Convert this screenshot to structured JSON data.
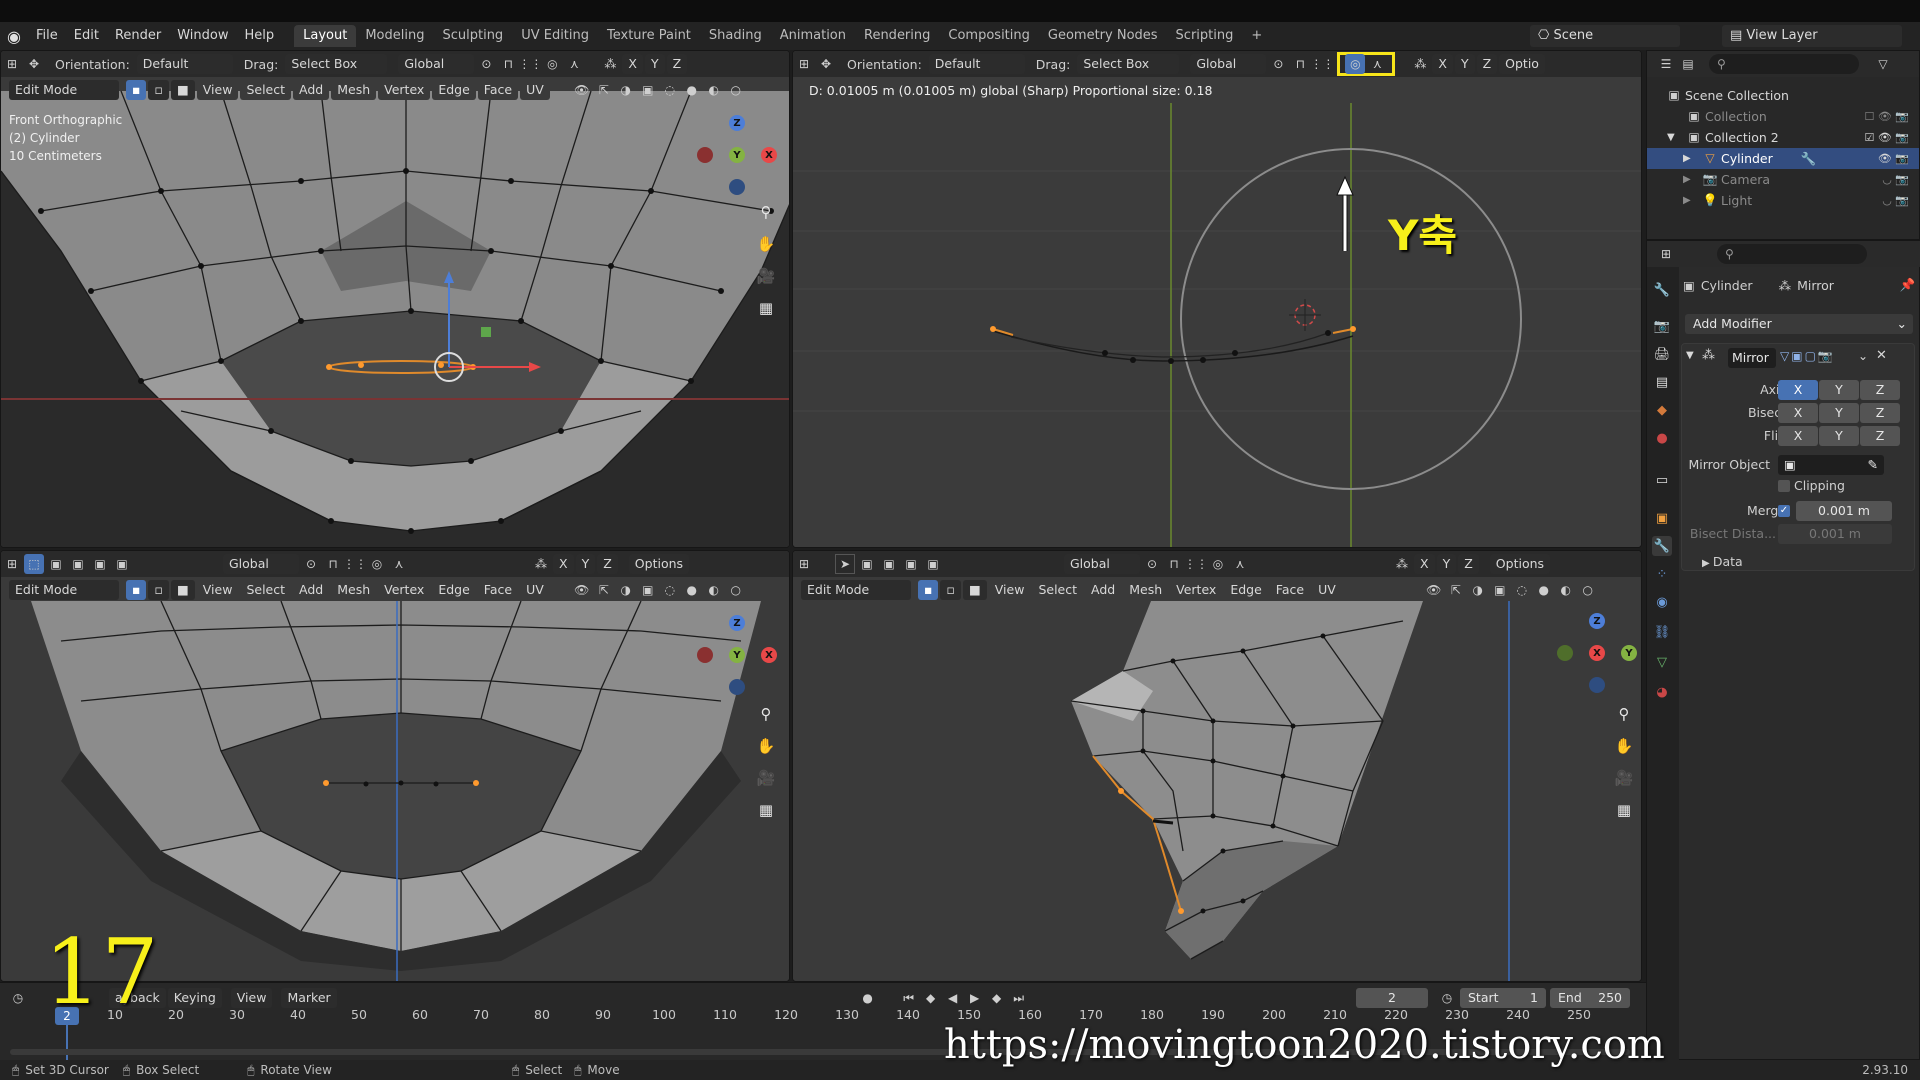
{
  "topbar": {
    "menus": [
      "File",
      "Edit",
      "Render",
      "Window",
      "Help"
    ],
    "workspaces": [
      "Layout",
      "Modeling",
      "Sculpting",
      "UV Editing",
      "Texture Paint",
      "Shading",
      "Animation",
      "Rendering",
      "Compositing",
      "Geometry Nodes",
      "Scripting"
    ],
    "active_workspace": "Layout",
    "add_tab": "+",
    "scene": "Scene",
    "view_layer": "View Layer"
  },
  "viewport_tl": {
    "orientation_label": "Orientation:",
    "orientation_value": "Default",
    "drag_label": "Drag:",
    "drag_value": "Select Box",
    "transform_space": "Global",
    "axes": [
      "X",
      "Y",
      "Z"
    ],
    "mode": "Edit Mode",
    "menus": [
      "View",
      "Select",
      "Add",
      "Mesh",
      "Vertex",
      "Edge",
      "Face",
      "UV"
    ],
    "info_line1": "Front Orthographic",
    "info_line2": "(2) Cylinder",
    "info_line3": "10 Centimeters"
  },
  "viewport_tr": {
    "orientation_label": "Orientation:",
    "orientation_value": "Default",
    "drag_label": "Drag:",
    "drag_value": "Select Box",
    "transform_space": "Global",
    "axes": [
      "X",
      "Y",
      "Z"
    ],
    "options_label": "Optio",
    "status_text": "D: 0.01005 m (0.01005 m) global (Sharp)  Proportional size: 0.18",
    "annotation": "Y축"
  },
  "viewport_bl": {
    "transform_space": "Global",
    "axes": [
      "X",
      "Y",
      "Z"
    ],
    "options_label": "Options",
    "mode": "Edit Mode",
    "menus": [
      "View",
      "Select",
      "Add",
      "Mesh",
      "Vertex",
      "Edge",
      "Face",
      "UV"
    ]
  },
  "viewport_br": {
    "transform_space": "Global",
    "axes": [
      "X",
      "Y",
      "Z"
    ],
    "options_label": "Options",
    "mode": "Edit Mode",
    "menus": [
      "View",
      "Select",
      "Add",
      "Mesh",
      "Vertex",
      "Edge",
      "Face",
      "UV"
    ]
  },
  "outliner": {
    "root": "Scene Collection",
    "rows": [
      {
        "label": "Collection",
        "dim": true
      },
      {
        "label": "Collection 2",
        "dim": false
      },
      {
        "label": "Cylinder",
        "dim": false,
        "selected": true
      },
      {
        "label": "Camera",
        "dim": true
      },
      {
        "label": "Light",
        "dim": true
      }
    ]
  },
  "properties": {
    "object_name": "Cylinder",
    "modifier_type": "Mirror",
    "add_modifier": "Add Modifier",
    "modifier_name": "Mirror",
    "axis_label": "Axis",
    "bisect_label": "Bisect",
    "flip_label": "Flip",
    "xyz": [
      "X",
      "Y",
      "Z"
    ],
    "mirror_object_label": "Mirror Object",
    "clipping_label": "Clipping",
    "merge_label": "Merge",
    "merge_value": "0.001 m",
    "bisect_distance_label": "Bisect Dista...",
    "bisect_distance_value": "0.001 m",
    "data_label": "Data"
  },
  "timeline": {
    "playback_label": "ayback",
    "keying_label": "Keying",
    "view_label": "View",
    "marker_label": "Marker",
    "current_frame": "2",
    "start_label": "Start",
    "start_value": "1",
    "end_label": "End",
    "end_value": "250",
    "ticks": [
      "10",
      "20",
      "30",
      "40",
      "50",
      "60",
      "70",
      "80",
      "90",
      "100",
      "110",
      "120",
      "130",
      "140",
      "150",
      "160",
      "170",
      "180",
      "190",
      "200",
      "210",
      "220",
      "230",
      "240",
      "250"
    ],
    "frame_badge": "2"
  },
  "statusbar": {
    "items": [
      "Set 3D Cursor",
      "Box Select",
      "Rotate View",
      "Select",
      "Move"
    ],
    "version": "2.93.10"
  },
  "overlay": {
    "step_number": "17",
    "watermark": "https://movingtoon2020.tistory.com"
  }
}
